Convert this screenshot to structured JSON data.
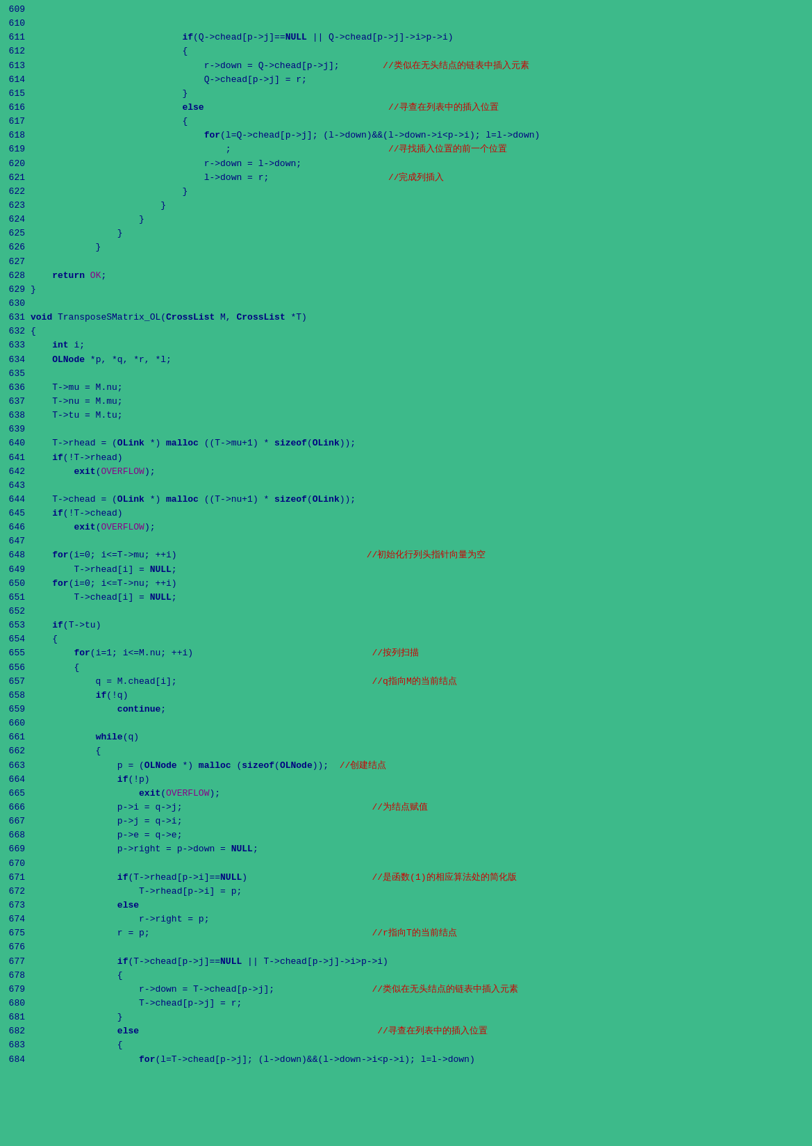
{
  "lines": [
    {
      "num": "609",
      "content": ""
    },
    {
      "num": "610",
      "content": ""
    },
    {
      "num": "611",
      "content": "                            if(Q->chead[p->j]==NULL || Q->chead[p->j]->i>p->i)"
    },
    {
      "num": "612",
      "content": "                            {"
    },
    {
      "num": "613",
      "content": "                                r->down = Q->chead[p->j];        //类似在无头结点的链表中插入元素"
    },
    {
      "num": "614",
      "content": "                                Q->chead[p->j] = r;"
    },
    {
      "num": "615",
      "content": "                            }"
    },
    {
      "num": "616",
      "content": "                            else                                  //寻查在列表中的插入位置"
    },
    {
      "num": "617",
      "content": "                            {"
    },
    {
      "num": "618",
      "content": "                                for(l=Q->chead[p->j]; (l->down)&&(l->down->i<p->i); l=l->down)"
    },
    {
      "num": "619",
      "content": "                                    ;                             //寻找插入位置的前一个位置"
    },
    {
      "num": "620",
      "content": "                                r->down = l->down;"
    },
    {
      "num": "621",
      "content": "                                l->down = r;                      //完成列插入"
    },
    {
      "num": "622",
      "content": "                            }"
    },
    {
      "num": "623",
      "content": "                        }"
    },
    {
      "num": "624",
      "content": "                    }"
    },
    {
      "num": "625",
      "content": "                }"
    },
    {
      "num": "626",
      "content": "            }"
    },
    {
      "num": "627",
      "content": ""
    },
    {
      "num": "628",
      "content": "    return OK;"
    },
    {
      "num": "629",
      "content": "}"
    },
    {
      "num": "630",
      "content": ""
    },
    {
      "num": "631",
      "content": "void TransposeSMatrix_OL(CrossList M, CrossList *T)"
    },
    {
      "num": "632",
      "content": "{"
    },
    {
      "num": "633",
      "content": "    int i;"
    },
    {
      "num": "634",
      "content": "    OLNode *p, *q, *r, *l;"
    },
    {
      "num": "635",
      "content": ""
    },
    {
      "num": "636",
      "content": "    T->mu = M.nu;"
    },
    {
      "num": "637",
      "content": "    T->nu = M.mu;"
    },
    {
      "num": "638",
      "content": "    T->tu = M.tu;"
    },
    {
      "num": "639",
      "content": ""
    },
    {
      "num": "640",
      "content": "    T->rhead = (OLink *) malloc ((T->mu+1) * sizeof(OLink));"
    },
    {
      "num": "641",
      "content": "    if(!T->rhead)"
    },
    {
      "num": "642",
      "content": "        exit(OVERFLOW);"
    },
    {
      "num": "643",
      "content": ""
    },
    {
      "num": "644",
      "content": "    T->chead = (OLink *) malloc ((T->nu+1) * sizeof(OLink));"
    },
    {
      "num": "645",
      "content": "    if(!T->chead)"
    },
    {
      "num": "646",
      "content": "        exit(OVERFLOW);"
    },
    {
      "num": "647",
      "content": ""
    },
    {
      "num": "648",
      "content": "    for(i=0; i<=T->mu; ++i)                                   //初始化行列头指针向量为空"
    },
    {
      "num": "649",
      "content": "        T->rhead[i] = NULL;"
    },
    {
      "num": "650",
      "content": "    for(i=0; i<=T->nu; ++i)"
    },
    {
      "num": "651",
      "content": "        T->chead[i] = NULL;"
    },
    {
      "num": "652",
      "content": ""
    },
    {
      "num": "653",
      "content": "    if(T->tu)"
    },
    {
      "num": "654",
      "content": "    {"
    },
    {
      "num": "655",
      "content": "        for(i=1; i<=M.nu; ++i)                                 //按列扫描"
    },
    {
      "num": "656",
      "content": "        {"
    },
    {
      "num": "657",
      "content": "            q = M.chead[i];                                    //q指向M的当前结点"
    },
    {
      "num": "658",
      "content": "            if(!q)"
    },
    {
      "num": "659",
      "content": "                continue;"
    },
    {
      "num": "660",
      "content": ""
    },
    {
      "num": "661",
      "content": "            while(q)"
    },
    {
      "num": "662",
      "content": "            {"
    },
    {
      "num": "663",
      "content": "                p = (OLNode *) malloc (sizeof(OLNode));  //创建结点"
    },
    {
      "num": "664",
      "content": "                if(!p)"
    },
    {
      "num": "665",
      "content": "                    exit(OVERFLOW);"
    },
    {
      "num": "666",
      "content": "                p->i = q->j;                                   //为结点赋值"
    },
    {
      "num": "667",
      "content": "                p->j = q->i;"
    },
    {
      "num": "668",
      "content": "                p->e = q->e;"
    },
    {
      "num": "669",
      "content": "                p->right = p->down = NULL;"
    },
    {
      "num": "670",
      "content": ""
    },
    {
      "num": "671",
      "content": "                if(T->rhead[p->i]==NULL)                       //是函数(1)的相应算法处的简化版"
    },
    {
      "num": "672",
      "content": "                    T->rhead[p->i] = p;"
    },
    {
      "num": "673",
      "content": "                else"
    },
    {
      "num": "674",
      "content": "                    r->right = p;"
    },
    {
      "num": "675",
      "content": "                r = p;                                         //r指向T的当前结点"
    },
    {
      "num": "676",
      "content": ""
    },
    {
      "num": "677",
      "content": "                if(T->chead[p->j]==NULL || T->chead[p->j]->i>p->i)"
    },
    {
      "num": "678",
      "content": "                {"
    },
    {
      "num": "679",
      "content": "                    r->down = T->chead[p->j];                  //类似在无头结点的链表中插入元素"
    },
    {
      "num": "680",
      "content": "                    T->chead[p->j] = r;"
    },
    {
      "num": "681",
      "content": "                }"
    },
    {
      "num": "682",
      "content": "                else                                            //寻查在列表中的插入位置"
    },
    {
      "num": "683",
      "content": "                {"
    },
    {
      "num": "684",
      "content": "                    for(l=T->chead[p->j]; (l->down)&&(l->down->i<p->i); l=l->down)"
    }
  ]
}
